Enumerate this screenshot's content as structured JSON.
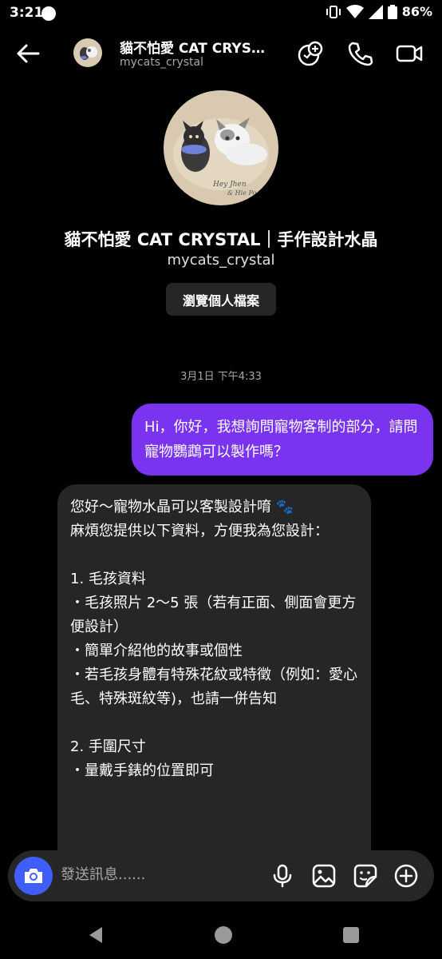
{
  "status": {
    "time": "3:21",
    "battery": "86%"
  },
  "header": {
    "name": "貓不怕愛 CAT CRYST...",
    "handle": "mycats_crystal"
  },
  "profile": {
    "name": "貓不怕愛 CAT CRYSTAL｜手作設計水晶",
    "handle": "mycats_crystal",
    "view_button": "瀏覽個人檔案"
  },
  "chat": {
    "timestamp": "3月1日 下午4:33",
    "outgoing": {
      "text": "Hi，你好，我想詢問寵物客制的部分，請問寵物鸚鵡可以製作嗎？"
    },
    "incoming": {
      "lines": [
        "您好～寵物水晶可以客製設計唷 🐾",
        "麻煩您提供以下資料，方便我為您設計：",
        "",
        "1. 毛孩資料",
        "・毛孩照片 2～5 張（若有正面、側面會更方便設計）",
        "・簡單介紹他的故事或個性",
        "・若毛孩身體有特殊花紋或特徵（例如：愛心毛、特殊斑紋等)，也請一併告知",
        "",
        "2. 手圍尺寸",
        "・量戴手錶的位置即可"
      ]
    }
  },
  "composer": {
    "placeholder": "發送訊息......"
  },
  "colors": {
    "accent": "#7a33ef",
    "camera": "#3f5efb",
    "bubble_in": "#262626"
  },
  "icons": [
    "back-arrow-icon",
    "video-chat-icon",
    "phone-icon",
    "video-camera-icon",
    "camera-icon",
    "microphone-icon",
    "gallery-icon",
    "sticker-icon",
    "plus-icon"
  ]
}
